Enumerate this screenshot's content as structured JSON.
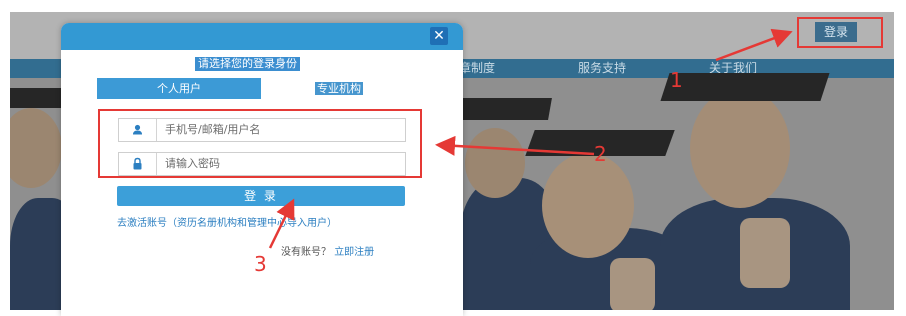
{
  "nav": {
    "items": [
      "章制度",
      "服务支持",
      "关于我们"
    ]
  },
  "topbar": {
    "login_label": "登录"
  },
  "dialog": {
    "close_glyph": "✕",
    "title": "请选择您的登录身份",
    "tabs": {
      "personal": "个人用户",
      "org": "专业机构"
    },
    "username_placeholder": "手机号/邮箱/用户名",
    "password_placeholder": "请输入密码",
    "login_label": "登 录",
    "activate_text": "去激活账号（资历名册机构和管理中心导入用户）",
    "no_account_text": "没有账号？",
    "register_text": "立即注册"
  },
  "annotations": {
    "n1": "1",
    "n2": "2",
    "n3": "3"
  },
  "colors": {
    "accent": "#3399d3",
    "nav": "#326d90",
    "annotation": "#e53935"
  },
  "icons": {
    "user": "user-icon",
    "lock": "lock-icon",
    "close": "close-icon"
  }
}
